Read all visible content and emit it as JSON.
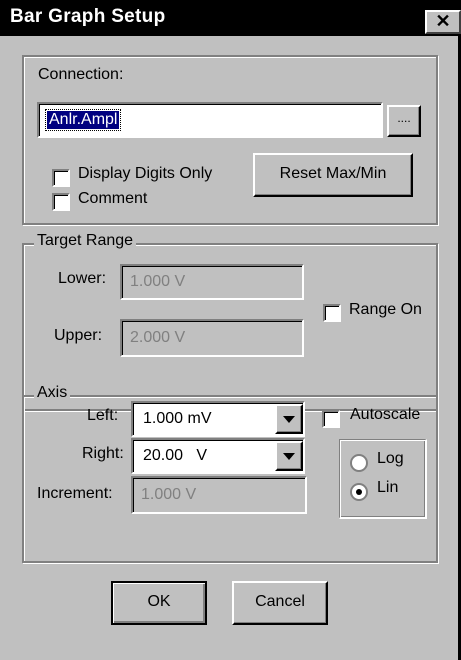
{
  "window": {
    "title": "Bar Graph Setup",
    "close_glyph": "✕"
  },
  "connection": {
    "label": "Connection:",
    "value": "Anlr.Ampl",
    "browse_label": "....",
    "display_digits_label": "Display Digits Only",
    "comment_label": "Comment",
    "reset_label": "Reset Max/Min",
    "display_digits_checked": false,
    "comment_checked": false
  },
  "target_range": {
    "legend": "Target Range",
    "lower_label": "Lower:",
    "lower_value": "1.000  V",
    "upper_label": "Upper:",
    "upper_value": "2.000  V",
    "range_on_label": "Range On",
    "range_on_checked": false
  },
  "axis": {
    "legend": "Axis",
    "left_label": "Left:",
    "left_value": "1.000  mV",
    "right_label": "Right:",
    "right_value": "20.00   V",
    "increment_label": "Increment:",
    "increment_value": "1.000  V",
    "autoscale_label": "Autoscale",
    "autoscale_checked": false,
    "log_label": "Log",
    "lin_label": "Lin",
    "scale_selected": "Lin"
  },
  "buttons": {
    "ok": "OK",
    "cancel": "Cancel"
  },
  "colors": {
    "face": "#c0c0c0",
    "title_bg": "#000000",
    "selection": "#000080"
  }
}
